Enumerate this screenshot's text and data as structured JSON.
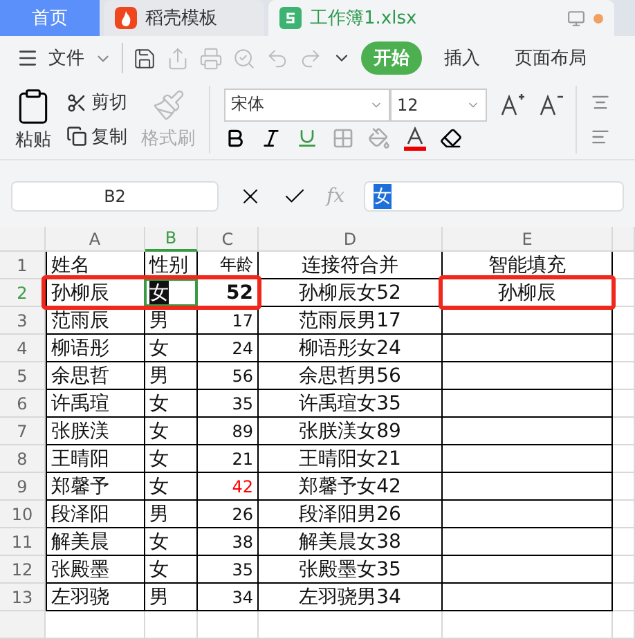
{
  "tabs": [
    {
      "kind": "home",
      "label": "首页",
      "selected": false
    },
    {
      "kind": "template",
      "label": "稻壳模板",
      "selected": false
    },
    {
      "kind": "sheet",
      "label": "工作簿1.xlsx",
      "selected": true
    }
  ],
  "menu": {
    "label": "文件"
  },
  "ribbon_tabs": [
    {
      "label": "开始",
      "selected": true
    },
    {
      "label": "插入",
      "selected": false
    },
    {
      "label": "页面布局",
      "selected": false
    }
  ],
  "clipboard": {
    "paste": "粘贴",
    "cut": "剪切",
    "copy": "复制",
    "format_painter": {
      "label": "格式刷",
      "disabled": true
    }
  },
  "font": {
    "name": "宋体",
    "size": "12"
  },
  "name_box": "B2",
  "formula": {
    "function_label": "fx",
    "value": "女"
  },
  "sheet": {
    "columns": [
      {
        "label": "A",
        "selected": false
      },
      {
        "label": "B",
        "selected": true
      },
      {
        "label": "C",
        "selected": false
      },
      {
        "label": "D",
        "selected": false
      },
      {
        "label": "E",
        "selected": false
      }
    ],
    "rows": [
      {
        "number": "1",
        "selected": false,
        "cells": [
          {
            "text": "姓名",
            "selected": false,
            "boxed": false
          },
          {
            "text": "性别",
            "selected": false,
            "boxed": false
          },
          {
            "text": "年龄",
            "selected": false,
            "boxed": false
          },
          {
            "text": "连接符合并",
            "selected": false,
            "boxed": false
          },
          {
            "text": "智能填充",
            "selected": false,
            "boxed": false
          }
        ]
      },
      {
        "number": "2",
        "selected": true,
        "cells": [
          {
            "text": "孙柳辰",
            "selected": false,
            "boxed": true
          },
          {
            "text": "女",
            "selected": true,
            "boxed": true
          },
          {
            "text": "52",
            "selected": false,
            "boxed": true,
            "bold": true
          },
          {
            "text": "孙柳辰女52",
            "selected": false,
            "boxed": false
          },
          {
            "text": "孙柳辰",
            "selected": false,
            "boxed": true
          }
        ]
      },
      {
        "number": "3",
        "selected": false,
        "cells": [
          {
            "text": "范雨辰",
            "selected": false,
            "boxed": false
          },
          {
            "text": "男",
            "selected": false,
            "boxed": false
          },
          {
            "text": "17",
            "selected": false,
            "boxed": false
          },
          {
            "text": "范雨辰男17",
            "selected": false,
            "boxed": false
          }
        ]
      },
      {
        "number": "4",
        "selected": false,
        "cells": [
          {
            "text": "柳语彤",
            "selected": false,
            "boxed": false
          },
          {
            "text": "女",
            "selected": false,
            "boxed": false
          },
          {
            "text": "24",
            "selected": false,
            "boxed": false
          },
          {
            "text": "柳语彤女24",
            "selected": false,
            "boxed": false
          }
        ]
      },
      {
        "number": "5",
        "selected": false,
        "cells": [
          {
            "text": "余思哲",
            "selected": false,
            "boxed": false
          },
          {
            "text": "男",
            "selected": false,
            "boxed": false
          },
          {
            "text": "56",
            "selected": false,
            "boxed": false
          },
          {
            "text": "余思哲男56",
            "selected": false,
            "boxed": false
          }
        ]
      },
      {
        "number": "6",
        "selected": false,
        "cells": [
          {
            "text": "许禹瑄",
            "selected": false,
            "boxed": false
          },
          {
            "text": "女",
            "selected": false,
            "boxed": false
          },
          {
            "text": "35",
            "selected": false,
            "boxed": false
          },
          {
            "text": "许禹瑄女35",
            "selected": false,
            "boxed": false
          }
        ]
      },
      {
        "number": "7",
        "selected": false,
        "cells": [
          {
            "text": "张朕渼",
            "selected": false,
            "boxed": false
          },
          {
            "text": "女",
            "selected": false,
            "boxed": false
          },
          {
            "text": "89",
            "selected": false,
            "boxed": false
          },
          {
            "text": "张朕渼女89",
            "selected": false,
            "boxed": false
          }
        ]
      },
      {
        "number": "8",
        "selected": false,
        "cells": [
          {
            "text": "王晴阳",
            "selected": false,
            "boxed": false
          },
          {
            "text": "女",
            "selected": false,
            "boxed": false
          },
          {
            "text": "21",
            "selected": false,
            "boxed": false
          },
          {
            "text": "王晴阳女21",
            "selected": false,
            "boxed": false
          }
        ]
      },
      {
        "number": "9",
        "selected": false,
        "cells": [
          {
            "text": "郑馨予",
            "selected": false,
            "boxed": false
          },
          {
            "text": "女",
            "selected": false,
            "boxed": false
          },
          {
            "text": "42",
            "selected": false,
            "boxed": false,
            "color": "#ff0000"
          },
          {
            "text": "郑馨予女42",
            "selected": false,
            "boxed": false
          }
        ]
      },
      {
        "number": "10",
        "selected": false,
        "cells": [
          {
            "text": "段泽阳",
            "selected": false,
            "boxed": false
          },
          {
            "text": "男",
            "selected": false,
            "boxed": false
          },
          {
            "text": "26",
            "selected": false,
            "boxed": false
          },
          {
            "text": "段泽阳男26",
            "selected": false,
            "boxed": false
          }
        ]
      },
      {
        "number": "11",
        "selected": false,
        "cells": [
          {
            "text": "解美晨",
            "selected": false,
            "boxed": false
          },
          {
            "text": "女",
            "selected": false,
            "boxed": false
          },
          {
            "text": "38",
            "selected": false,
            "boxed": false
          },
          {
            "text": "解美晨女38",
            "selected": false,
            "boxed": false
          }
        ]
      },
      {
        "number": "12",
        "selected": false,
        "cells": [
          {
            "text": "张殿墨",
            "selected": false,
            "boxed": false
          },
          {
            "text": "女",
            "selected": false,
            "boxed": false
          },
          {
            "text": "35",
            "selected": false,
            "boxed": false
          },
          {
            "text": "张殿墨女35",
            "selected": false,
            "boxed": false
          }
        ]
      },
      {
        "number": "13",
        "selected": false,
        "cells": [
          {
            "text": "左羽骁",
            "selected": false,
            "boxed": false
          },
          {
            "text": "男",
            "selected": false,
            "boxed": false
          },
          {
            "text": "34",
            "selected": false,
            "boxed": false
          },
          {
            "text": "左羽骁男34",
            "selected": false,
            "boxed": false
          }
        ]
      }
    ]
  }
}
